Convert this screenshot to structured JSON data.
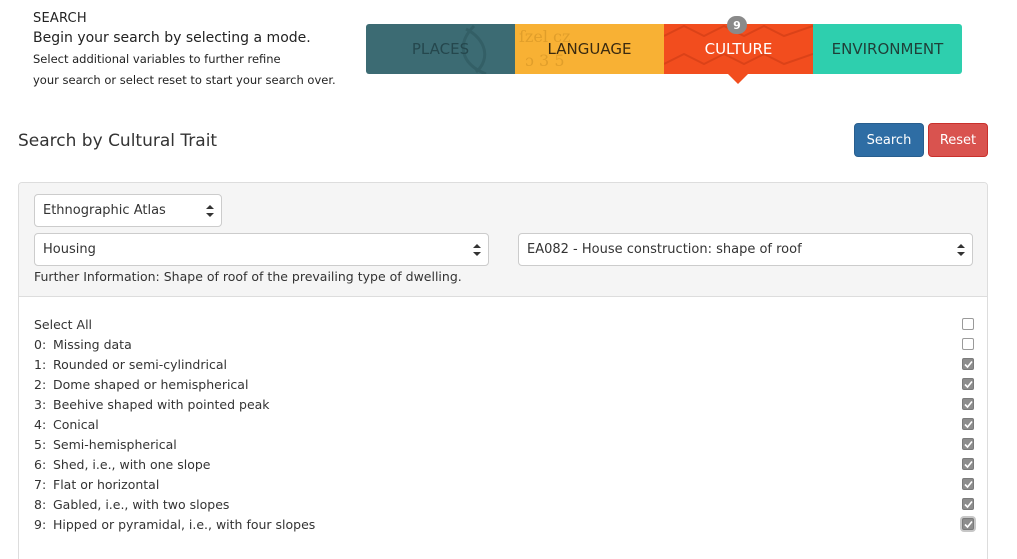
{
  "intro": {
    "heading": "SEARCH",
    "lead": "Begin your search by selecting a mode.",
    "line1": "Select additional variables to further refine",
    "line2": "your search or select reset to start your search over."
  },
  "modes": {
    "places": "PLACES",
    "language": "LANGUAGE",
    "culture": "CULTURE",
    "environment": "ENVIRONMENT",
    "culture_badge": "9",
    "active": "culture"
  },
  "section_title": "Search by Cultural Trait",
  "buttons": {
    "search": "Search",
    "reset": "Reset"
  },
  "colors": {
    "places": "#3c6b73",
    "language": "#f8b134",
    "culture": "#f24d1e",
    "environment": "#2ecfae",
    "search_button": "#2e6da4",
    "reset_button": "#d9534f"
  },
  "filters": {
    "source": "Ethnographic Atlas",
    "category": "Housing",
    "variable": "EA082 - House construction: shape of roof",
    "further_info": "Further Information: Shape of roof of the prevailing type of dwelling."
  },
  "select_all": {
    "label": "Select All",
    "checked": false
  },
  "options": [
    {
      "code": "0:",
      "label": "Missing data",
      "checked": false
    },
    {
      "code": "1:",
      "label": "Rounded or semi-cylindrical",
      "checked": true
    },
    {
      "code": "2:",
      "label": "Dome shaped or hemispherical",
      "checked": true
    },
    {
      "code": "3:",
      "label": "Beehive shaped with pointed peak",
      "checked": true
    },
    {
      "code": "4:",
      "label": "Conical",
      "checked": true
    },
    {
      "code": "5:",
      "label": "Semi-hemispherical",
      "checked": true
    },
    {
      "code": "6:",
      "label": "Shed, i.e., with one slope",
      "checked": true
    },
    {
      "code": "7:",
      "label": "Flat or horizontal",
      "checked": true
    },
    {
      "code": "8:",
      "label": "Gabled, i.e., with two slopes",
      "checked": true
    },
    {
      "code": "9:",
      "label": "Hipped or pyramidal, i.e., with four slopes",
      "checked": true
    }
  ]
}
